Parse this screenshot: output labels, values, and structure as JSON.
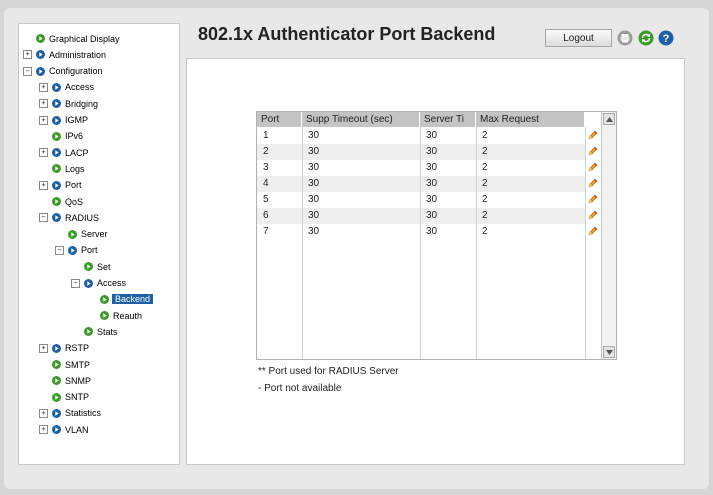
{
  "page": {
    "title": "802.1x Authenticator Port Backend"
  },
  "toolbar": {
    "logout_label": "Logout"
  },
  "nav": {
    "items": [
      {
        "label": "Graphical Display",
        "expander": ""
      },
      {
        "label": "Administration",
        "expander": "+"
      },
      {
        "label": "Configuration",
        "expander": "−"
      },
      {
        "label": "Access",
        "expander": "+"
      },
      {
        "label": "Bridging",
        "expander": "+"
      },
      {
        "label": "IGMP",
        "expander": "+"
      },
      {
        "label": "IPv6",
        "expander": ""
      },
      {
        "label": "LACP",
        "expander": "+"
      },
      {
        "label": "Logs",
        "expander": ""
      },
      {
        "label": "Port",
        "expander": "+"
      },
      {
        "label": "QoS",
        "expander": ""
      },
      {
        "label": "RADIUS",
        "expander": "−"
      },
      {
        "label": "Server",
        "expander": ""
      },
      {
        "label": "Port",
        "expander": "−"
      },
      {
        "label": "Set",
        "expander": ""
      },
      {
        "label": "Access",
        "expander": "−"
      },
      {
        "label": "Backend",
        "expander": "",
        "selected": true
      },
      {
        "label": "Reauth",
        "expander": ""
      },
      {
        "label": "Stats",
        "expander": ""
      },
      {
        "label": "RSTP",
        "expander": "+"
      },
      {
        "label": "SMTP",
        "expander": ""
      },
      {
        "label": "SNMP",
        "expander": ""
      },
      {
        "label": "SNTP",
        "expander": ""
      },
      {
        "label": "Statistics",
        "expander": "+"
      },
      {
        "label": "VLAN",
        "expander": "+"
      }
    ]
  },
  "table": {
    "columns": [
      "Port",
      "Supp Timeout (sec)",
      "Server Ti",
      "Max Request"
    ],
    "rows": [
      [
        "1",
        "30",
        "30",
        "2"
      ],
      [
        "2",
        "30",
        "30",
        "2"
      ],
      [
        "3",
        "30",
        "30",
        "2"
      ],
      [
        "4",
        "30",
        "30",
        "2"
      ],
      [
        "5",
        "30",
        "30",
        "2"
      ],
      [
        "6",
        "30",
        "30",
        "2"
      ],
      [
        "7",
        "30",
        "30",
        "2"
      ]
    ]
  },
  "notes": {
    "radius_note": "** Port used for RADIUS Server",
    "na_note": "- Port not available"
  },
  "colors": {
    "arrow_blue": "#1f5fa8",
    "arrow_green": "#3a9a2a",
    "selected_bg": "#1f5fa8"
  }
}
